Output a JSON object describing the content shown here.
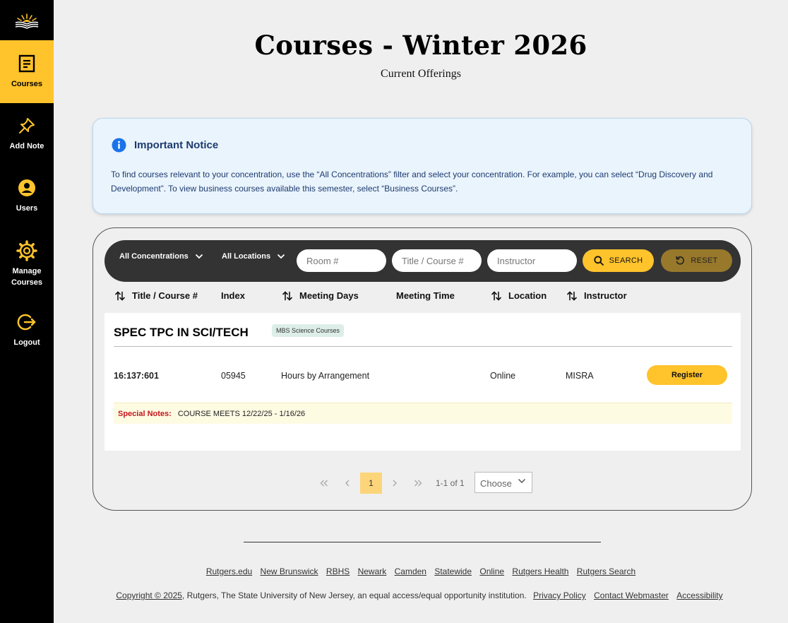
{
  "sidebar": {
    "items": [
      {
        "label": "Courses",
        "icon": "document-icon",
        "active": true
      },
      {
        "label": "Add Note",
        "icon": "pin-icon"
      },
      {
        "label": "Users",
        "icon": "user-icon"
      },
      {
        "label": "Manage Courses",
        "icon": "gear-icon"
      },
      {
        "label": "Logout",
        "icon": "logout-icon"
      }
    ]
  },
  "header": {
    "title": "Courses - Winter 2026",
    "subtitle": "Current Offerings"
  },
  "notice": {
    "title": "Important Notice",
    "body": "To find courses relevant to your concentration, use the “All Concentrations” filter and select your concentration. For example, you can select “Drug Discovery and Development”. To view business courses available this semester, select “Business Courses”."
  },
  "filters": {
    "concentration": "All Concentrations",
    "location": "All Locations",
    "room_placeholder": "Room #",
    "title_placeholder": "Title / Course #",
    "instructor_placeholder": "Instructor",
    "search_label": "SEARCH",
    "reset_label": "RESET"
  },
  "columns": {
    "title": "Title / Course #",
    "index": "Index",
    "days": "Meeting Days",
    "time": "Meeting Time",
    "location": "Location",
    "instructor": "Instructor"
  },
  "course": {
    "title": "SPEC TPC IN SCI/TECH",
    "tag": "MBS Science Courses",
    "number": "16:137:601",
    "index": "05945",
    "days": "Hours by Arrangement",
    "time": "",
    "location": "Online",
    "instructor": "MISRA",
    "register_label": "Register",
    "notes_label": "Special Notes:",
    "notes_value": "COURSE MEETS 12/22/25 - 1/16/26"
  },
  "pagination": {
    "current": "1",
    "range": "1-1 of 1",
    "per_page": "Choose"
  },
  "footer": {
    "links": [
      "Rutgers.edu",
      "New Brunswick",
      "RBHS",
      "Newark",
      "Camden",
      "Statewide",
      "Online",
      "Rutgers Health",
      "Rutgers Search"
    ],
    "copyright_link": "Copyright © 2025",
    "copyright_text": ", Rutgers, The State University of New Jersey, an equal access/equal opportunity institution.",
    "privacy": "Privacy Policy",
    "webmaster": "Contact Webmaster",
    "accessibility": "Accessibility"
  },
  "colors": {
    "accent": "#ffc32b",
    "reset": "#98782b",
    "sidebar": "#000000",
    "notice_bg": "#eaf4fd",
    "notice_icon": "#1a73e8",
    "special_notes": "#c2151c"
  }
}
